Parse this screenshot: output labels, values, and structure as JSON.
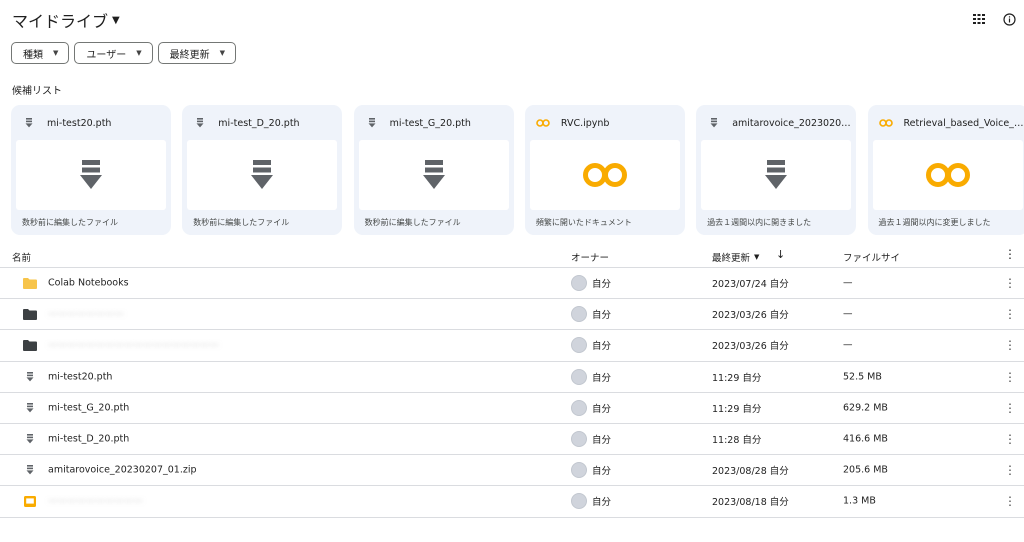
{
  "header": {
    "title": "マイドライブ"
  },
  "filters": [
    {
      "label": "種類"
    },
    {
      "label": "ユーザー"
    },
    {
      "label": "最終更新"
    }
  ],
  "suggested": {
    "label": "候補リスト",
    "cards": [
      {
        "name": "mi-test20.pth",
        "icon": "file-icon",
        "preview": "file-large-icon",
        "subtitle": "数秒前に編集したファイル"
      },
      {
        "name": "mi-test_D_20.pth",
        "icon": "file-icon",
        "preview": "file-large-icon",
        "subtitle": "数秒前に編集したファイル"
      },
      {
        "name": "mi-test_G_20.pth",
        "icon": "file-icon",
        "preview": "file-large-icon",
        "subtitle": "数秒前に編集したファイル"
      },
      {
        "name": "RVC.ipynb",
        "icon": "colab-icon",
        "preview": "colab-large-icon",
        "subtitle": "頻繁に開いたドキュメント"
      },
      {
        "name": "amitarovoice_20230207...",
        "icon": "file-icon",
        "preview": "file-large-icon",
        "subtitle": "過去１週間以内に開きました"
      },
      {
        "name": "Retrieval_based_Voice_C...",
        "icon": "colab-icon",
        "preview": "colab-large-icon",
        "subtitle": "過去１週間以内に変更しました"
      }
    ]
  },
  "list": {
    "columns": {
      "name": "名前",
      "owner": "オーナー",
      "modified": "最終更新",
      "size": "ファイルサイ"
    },
    "rows": [
      {
        "icon": "folder-yellow-icon",
        "name": "Colab Notebooks",
        "owner": "自分",
        "modified": "2023/07/24 自分",
        "size": "—",
        "blurred": false
      },
      {
        "icon": "folder-dark-icon",
        "name": "————————",
        "owner": "自分",
        "modified": "2023/03/26 自分",
        "size": "—",
        "blurred": true
      },
      {
        "icon": "folder-dark-icon",
        "name": "——————————————————",
        "owner": "自分",
        "modified": "2023/03/26 自分",
        "size": "—",
        "blurred": true
      },
      {
        "icon": "file-icon",
        "name": "mi-test20.pth",
        "owner": "自分",
        "modified": "11:29 自分",
        "size": "52.5 MB",
        "blurred": false
      },
      {
        "icon": "file-icon",
        "name": "mi-test_G_20.pth",
        "owner": "自分",
        "modified": "11:29 自分",
        "size": "629.2 MB",
        "blurred": false
      },
      {
        "icon": "file-icon",
        "name": "mi-test_D_20.pth",
        "owner": "自分",
        "modified": "11:28 自分",
        "size": "416.6 MB",
        "blurred": false
      },
      {
        "icon": "file-icon",
        "name": "amitarovoice_20230207_01.zip",
        "owner": "自分",
        "modified": "2023/08/28 自分",
        "size": "205.6 MB",
        "blurred": false
      },
      {
        "icon": "slides-icon",
        "name": "——————————",
        "owner": "自分",
        "modified": "2023/08/18 自分",
        "size": "1.3 MB",
        "blurred": true
      }
    ]
  },
  "colors": {
    "card_bg": "#eff3fa",
    "folder_yellow": "#f7c44a",
    "folder_dark": "#5f6368",
    "colab": "#f9ab00",
    "file_icon": "#5f6368"
  }
}
